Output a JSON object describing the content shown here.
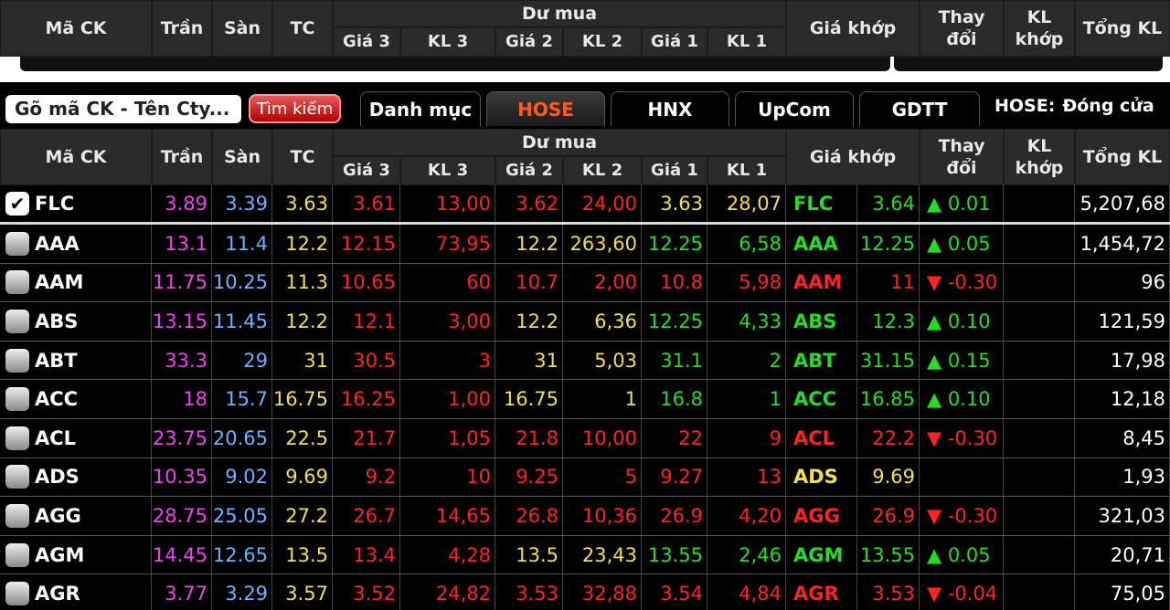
{
  "header": {
    "ma_ck": "Mã CK",
    "tran": "Trần",
    "san": "Sàn",
    "tc": "TC",
    "du_mua": "Dư mua",
    "gia3": "Giá 3",
    "kl3": "KL 3",
    "gia2": "Giá 2",
    "kl2": "KL 2",
    "gia1": "Giá 1",
    "kl1": "KL 1",
    "gia_khop": "Giá khớp",
    "thay_doi": "Thay đổi",
    "kl_khop": "KL khớp",
    "tong_kl": "Tổng KL"
  },
  "toolbar": {
    "search_text": "Gõ mã CK - Tên Cty...",
    "search_button": "Tìm kiếm",
    "tabs": [
      "Danh mục",
      "HOSE",
      "HNX",
      "UpCom",
      "GDTT"
    ],
    "active_tab": "HOSE",
    "market_label": "HOSE:",
    "market_status": "Đóng cửa"
  },
  "icons": {
    "checked": "checkbox-checked-icon",
    "unchecked": "checkbox-unchecked-icon",
    "up": "triangle-up-icon",
    "down": "triangle-down-icon"
  },
  "colors": {
    "ceiling": "#ee44ee",
    "floor": "#66b3ff",
    "reference": "#f0e050",
    "up": "#22dd22",
    "down": "#ff2222"
  },
  "rows": [
    {
      "ma": "FLC",
      "checked": true,
      "tran": "3.89",
      "san": "3.39",
      "tc": "3.63",
      "g3": "3.61",
      "k3": "13,00",
      "g2": "3.62",
      "k2": "24,00",
      "g1": "3.63",
      "k1": "28,07",
      "mk": "FLC",
      "khop": "3.64",
      "td": "▲ 0.01",
      "klk": "",
      "tong": "5,207,68",
      "c": {
        "g3": "down",
        "k3": "down",
        "g2": "down",
        "k2": "down",
        "g1": "flat",
        "k1": "flat",
        "mk": "up",
        "khop": "up",
        "td": "up"
      }
    },
    {
      "ma": "AAA",
      "checked": false,
      "tran": "13.1",
      "san": "11.4",
      "tc": "12.2",
      "g3": "12.15",
      "k3": "73,95",
      "g2": "12.2",
      "k2": "263,60",
      "g1": "12.25",
      "k1": "6,58",
      "mk": "AAA",
      "khop": "12.25",
      "td": "▲ 0.05",
      "klk": "",
      "tong": "1,454,72",
      "c": {
        "g3": "down",
        "k3": "down",
        "g2": "flat",
        "k2": "flat",
        "g1": "up",
        "k1": "up",
        "mk": "up",
        "khop": "up",
        "td": "up"
      }
    },
    {
      "ma": "AAM",
      "checked": false,
      "tran": "11.75",
      "san": "10.25",
      "tc": "11.3",
      "g3": "10.65",
      "k3": "60",
      "g2": "10.7",
      "k2": "2,00",
      "g1": "10.8",
      "k1": "5,98",
      "mk": "AAM",
      "khop": "11",
      "td": "▼ -0.30",
      "klk": "",
      "tong": "96",
      "c": {
        "g3": "down",
        "k3": "down",
        "g2": "down",
        "k2": "down",
        "g1": "down",
        "k1": "down",
        "mk": "down",
        "khop": "down",
        "td": "down"
      }
    },
    {
      "ma": "ABS",
      "checked": false,
      "tran": "13.15",
      "san": "11.45",
      "tc": "12.2",
      "g3": "12.1",
      "k3": "3,00",
      "g2": "12.2",
      "k2": "6,36",
      "g1": "12.25",
      "k1": "4,33",
      "mk": "ABS",
      "khop": "12.3",
      "td": "▲ 0.10",
      "klk": "",
      "tong": "121,59",
      "c": {
        "g3": "down",
        "k3": "down",
        "g2": "flat",
        "k2": "flat",
        "g1": "up",
        "k1": "up",
        "mk": "up",
        "khop": "up",
        "td": "up"
      }
    },
    {
      "ma": "ABT",
      "checked": false,
      "tran": "33.3",
      "san": "29",
      "tc": "31",
      "g3": "30.5",
      "k3": "3",
      "g2": "31",
      "k2": "5,03",
      "g1": "31.1",
      "k1": "2",
      "mk": "ABT",
      "khop": "31.15",
      "td": "▲ 0.15",
      "klk": "",
      "tong": "17,98",
      "c": {
        "g3": "down",
        "k3": "down",
        "g2": "flat",
        "k2": "flat",
        "g1": "up",
        "k1": "up",
        "mk": "up",
        "khop": "up",
        "td": "up"
      }
    },
    {
      "ma": "ACC",
      "checked": false,
      "tran": "18",
      "san": "15.7",
      "tc": "16.75",
      "g3": "16.25",
      "k3": "1,00",
      "g2": "16.75",
      "k2": "1",
      "g1": "16.8",
      "k1": "1",
      "mk": "ACC",
      "khop": "16.85",
      "td": "▲ 0.10",
      "klk": "",
      "tong": "12,18",
      "c": {
        "g3": "down",
        "k3": "down",
        "g2": "flat",
        "k2": "flat",
        "g1": "up",
        "k1": "up",
        "mk": "up",
        "khop": "up",
        "td": "up"
      }
    },
    {
      "ma": "ACL",
      "checked": false,
      "tran": "23.75",
      "san": "20.65",
      "tc": "22.5",
      "g3": "21.7",
      "k3": "1,05",
      "g2": "21.8",
      "k2": "10,00",
      "g1": "22",
      "k1": "9",
      "mk": "ACL",
      "khop": "22.2",
      "td": "▼ -0.30",
      "klk": "",
      "tong": "8,45",
      "c": {
        "g3": "down",
        "k3": "down",
        "g2": "down",
        "k2": "down",
        "g1": "down",
        "k1": "down",
        "mk": "down",
        "khop": "down",
        "td": "down"
      }
    },
    {
      "ma": "ADS",
      "checked": false,
      "tran": "10.35",
      "san": "9.02",
      "tc": "9.69",
      "g3": "9.2",
      "k3": "10",
      "g2": "9.25",
      "k2": "5",
      "g1": "9.27",
      "k1": "13",
      "mk": "ADS",
      "khop": "9.69",
      "td": "",
      "klk": "",
      "tong": "1,93",
      "c": {
        "g3": "down",
        "k3": "down",
        "g2": "down",
        "k2": "down",
        "g1": "down",
        "k1": "down",
        "mk": "flat",
        "khop": "flat",
        "td": "flat"
      }
    },
    {
      "ma": "AGG",
      "checked": false,
      "tran": "28.75",
      "san": "25.05",
      "tc": "27.2",
      "g3": "26.7",
      "k3": "14,65",
      "g2": "26.8",
      "k2": "10,36",
      "g1": "26.9",
      "k1": "4,20",
      "mk": "AGG",
      "khop": "26.9",
      "td": "▼ -0.30",
      "klk": "",
      "tong": "321,03",
      "c": {
        "g3": "down",
        "k3": "down",
        "g2": "down",
        "k2": "down",
        "g1": "down",
        "k1": "down",
        "mk": "down",
        "khop": "down",
        "td": "down"
      }
    },
    {
      "ma": "AGM",
      "checked": false,
      "tran": "14.45",
      "san": "12.65",
      "tc": "13.5",
      "g3": "13.4",
      "k3": "4,28",
      "g2": "13.5",
      "k2": "23,43",
      "g1": "13.55",
      "k1": "2,46",
      "mk": "AGM",
      "khop": "13.55",
      "td": "▲ 0.05",
      "klk": "",
      "tong": "20,71",
      "c": {
        "g3": "down",
        "k3": "down",
        "g2": "flat",
        "k2": "flat",
        "g1": "up",
        "k1": "up",
        "mk": "up",
        "khop": "up",
        "td": "up"
      }
    },
    {
      "ma": "AGR",
      "checked": false,
      "tran": "3.77",
      "san": "3.29",
      "tc": "3.57",
      "g3": "3.52",
      "k3": "24,82",
      "g2": "3.53",
      "k2": "32,88",
      "g1": "3.54",
      "k1": "4,84",
      "mk": "AGR",
      "khop": "3.53",
      "td": "▼ -0.04",
      "klk": "",
      "tong": "75,05",
      "c": {
        "g3": "down",
        "k3": "down",
        "g2": "down",
        "k2": "down",
        "g1": "down",
        "k1": "down",
        "mk": "down",
        "khop": "down",
        "td": "down"
      }
    }
  ]
}
